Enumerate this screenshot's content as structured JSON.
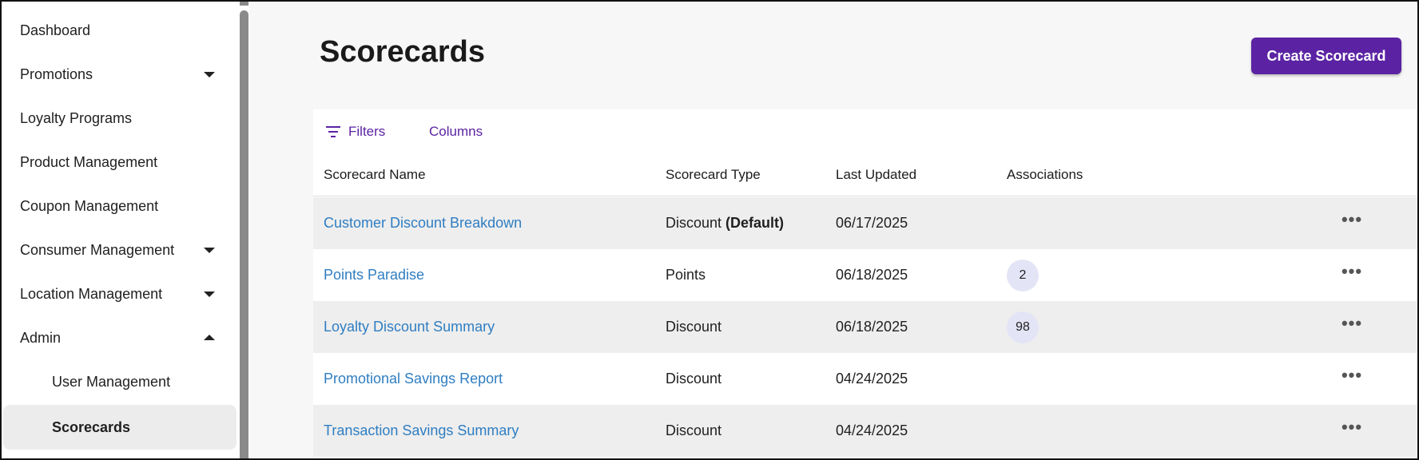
{
  "sidebar": {
    "items": [
      {
        "label": "Dashboard"
      },
      {
        "label": "Promotions"
      },
      {
        "label": "Loyalty Programs"
      },
      {
        "label": "Product Management"
      },
      {
        "label": "Coupon Management"
      },
      {
        "label": "Consumer Management"
      },
      {
        "label": "Location Management"
      },
      {
        "label": "Admin"
      },
      {
        "label": "User Management"
      },
      {
        "label": "Scorecards"
      }
    ]
  },
  "page": {
    "title": "Scorecards",
    "create_label": "Create Scorecard"
  },
  "toolbar": {
    "filters_label": "Filters",
    "columns_label": "Columns"
  },
  "table": {
    "headers": [
      "Scorecard Name",
      "Scorecard Type",
      "Last Updated",
      "Associations"
    ],
    "rows": [
      {
        "name": "Customer Discount Breakdown",
        "type": "Discount",
        "type_tag": "(Default)",
        "updated": "06/17/2025",
        "associations": ""
      },
      {
        "name": "Points Paradise",
        "type": "Points",
        "type_tag": "",
        "updated": "06/18/2025",
        "associations": "2"
      },
      {
        "name": "Loyalty Discount Summary",
        "type": "Discount",
        "type_tag": "",
        "updated": "06/18/2025",
        "associations": "98"
      },
      {
        "name": "Promotional Savings Report",
        "type": "Discount",
        "type_tag": "",
        "updated": "04/24/2025",
        "associations": ""
      },
      {
        "name": "Transaction Savings Summary",
        "type": "Discount",
        "type_tag": "",
        "updated": "04/24/2025",
        "associations": ""
      }
    ],
    "row_menu_glyph": "•••"
  },
  "colors": {
    "accent": "#5b23a3",
    "link": "#2f7ec2",
    "badge_bg": "#e4e4f7"
  }
}
